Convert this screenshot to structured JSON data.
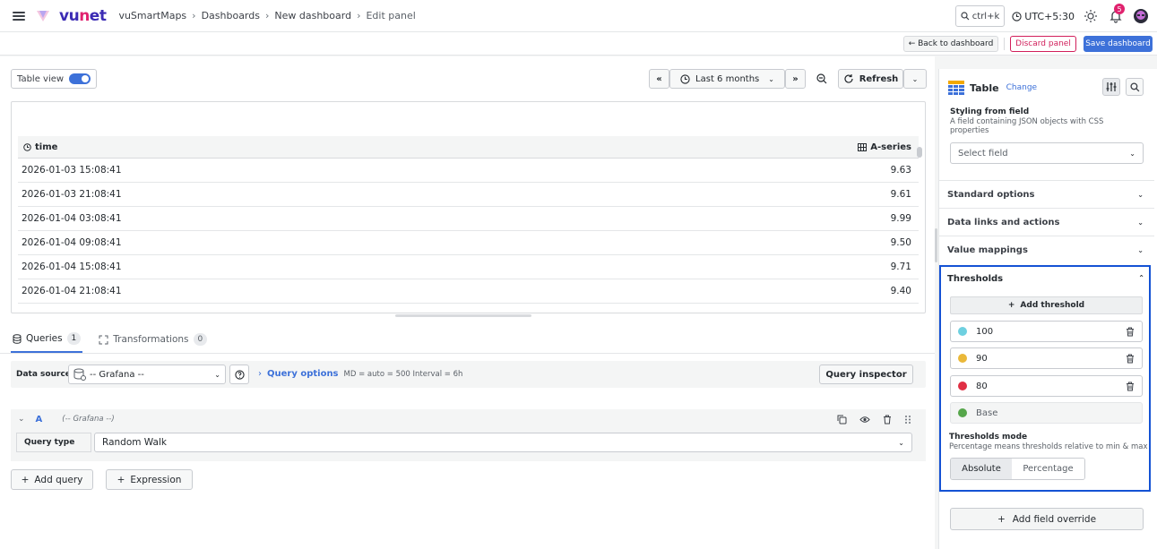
{
  "topbar": {
    "brand": "VUNet",
    "breadcrumbs": [
      "vuSmartMaps",
      "Dashboards",
      "New dashboard",
      "Edit panel"
    ],
    "breadcrumb_separator": "›",
    "search_shortcut": "ctrl+k",
    "timezone": "UTC+5:30",
    "notification_count": "5"
  },
  "actions": {
    "back": "← Back to dashboard",
    "discard": "Discard panel",
    "save": "Save dashboard"
  },
  "toolbar": {
    "table_view": "Table view",
    "time_range": "Last 6 months",
    "refresh": "Refresh"
  },
  "table": {
    "columns": [
      "time",
      "A-series"
    ],
    "rows": [
      {
        "time": "2026-01-03 15:08:41",
        "value": "9.63"
      },
      {
        "time": "2026-01-03 21:08:41",
        "value": "9.61"
      },
      {
        "time": "2026-01-04 03:08:41",
        "value": "9.99"
      },
      {
        "time": "2026-01-04 09:08:41",
        "value": "9.50"
      },
      {
        "time": "2026-01-04 15:08:41",
        "value": "9.71"
      },
      {
        "time": "2026-01-04 21:08:41",
        "value": "9.40"
      }
    ]
  },
  "tabs": [
    {
      "label": "Queries",
      "count": "1"
    },
    {
      "label": "Transformations",
      "count": "0"
    }
  ],
  "query": {
    "datasource_label": "Data source",
    "datasource_value": "-- Grafana --",
    "options_label": "Query options",
    "options_meta": "MD = auto = 500   Interval = 6h",
    "inspector": "Query inspector",
    "ref_id": "A",
    "ref_ds": "(-- Grafana --)",
    "type_label": "Query type",
    "type_value": "Random Walk",
    "add_query": "Add query",
    "expression": "Expression"
  },
  "sidebar": {
    "viz_name": "Table",
    "viz_change": "Change",
    "styling_title": "Styling from field",
    "styling_desc": "A field containing JSON objects with CSS properties",
    "select_placeholder": "Select field",
    "sections": [
      "Standard options",
      "Data links and actions",
      "Value mappings"
    ],
    "thresholds": {
      "title": "Thresholds",
      "add": "Add threshold",
      "items": [
        {
          "value": "100",
          "color": "#6ed0e0"
        },
        {
          "value": "90",
          "color": "#eab839"
        },
        {
          "value": "80",
          "color": "#e02f44"
        },
        {
          "value": "Base",
          "color": "#56a64b"
        }
      ],
      "mode_title": "Thresholds mode",
      "mode_desc": "Percentage means thresholds relative to min & max",
      "mode_options": [
        "Absolute",
        "Percentage"
      ]
    },
    "add_override": "Add field override"
  }
}
